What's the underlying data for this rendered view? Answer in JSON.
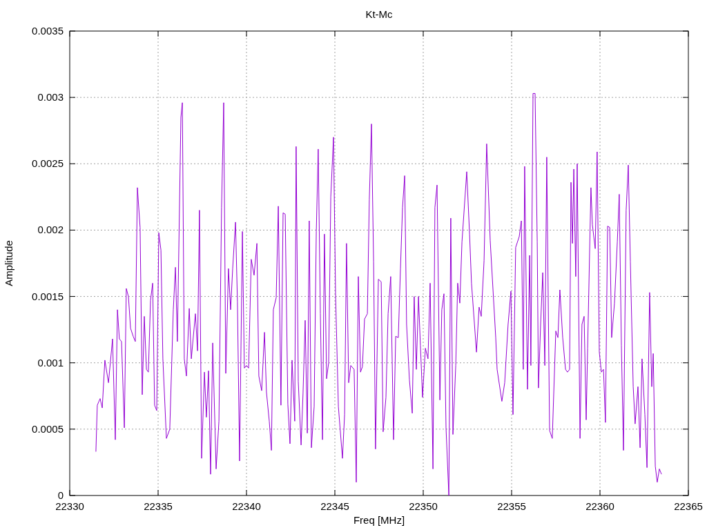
{
  "chart_data": {
    "type": "line",
    "grid": true,
    "title": "Kt-Mc",
    "xlabel": "Freq [MHz]",
    "ylabel": "Amplitude",
    "xlim": [
      22330,
      22365
    ],
    "ylim": [
      0,
      0.0035
    ],
    "xticks": [
      22330,
      22335,
      22340,
      22345,
      22350,
      22355,
      22360,
      22365
    ],
    "yticks": [
      0,
      0.0005,
      0.001,
      0.0015,
      0.002,
      0.0025,
      0.003,
      0.0035
    ],
    "x": [
      22331.48,
      22331.56,
      22331.72,
      22331.84,
      22331.99,
      22332.19,
      22332.42,
      22332.58,
      22332.7,
      22332.81,
      22332.93,
      22333.09,
      22333.2,
      22333.32,
      22333.44,
      22333.59,
      22333.71,
      22333.83,
      22333.98,
      22334.1,
      22334.22,
      22334.34,
      22334.45,
      22334.57,
      22334.69,
      22334.8,
      22334.92,
      22335.04,
      22335.16,
      22335.27,
      22335.47,
      22335.66,
      22335.86,
      22335.98,
      22336.09,
      22336.29,
      22336.37,
      22336.48,
      22336.6,
      22336.76,
      22336.88,
      22337.11,
      22337.23,
      22337.34,
      22337.46,
      22337.62,
      22337.73,
      22337.85,
      22337.97,
      22338.09,
      22338.28,
      22338.44,
      22338.59,
      22338.71,
      22338.83,
      22338.98,
      22339.1,
      22339.22,
      22339.38,
      22339.49,
      22339.61,
      22339.77,
      22339.88,
      22340.0,
      22340.12,
      22340.27,
      22340.43,
      22340.59,
      22340.7,
      22340.86,
      22341.02,
      22341.13,
      22341.29,
      22341.41,
      22341.52,
      22341.68,
      22341.8,
      22341.95,
      22342.07,
      22342.19,
      22342.34,
      22342.46,
      22342.58,
      22342.73,
      22342.81,
      22342.93,
      22343.09,
      22343.2,
      22343.32,
      22343.44,
      22343.55,
      22343.67,
      22343.83,
      22343.95,
      22344.06,
      22344.18,
      22344.3,
      22344.41,
      22344.53,
      22344.65,
      22344.77,
      22344.92,
      22345.04,
      22345.2,
      22345.43,
      22345.55,
      22345.66,
      22345.78,
      22345.9,
      22346.09,
      22346.21,
      22346.33,
      22346.45,
      22346.56,
      22346.68,
      22346.84,
      22346.95,
      22347.07,
      22347.19,
      22347.3,
      22347.46,
      22347.62,
      22347.73,
      22347.89,
      22348.01,
      22348.16,
      22348.32,
      22348.44,
      22348.59,
      22348.71,
      22348.83,
      22348.95,
      22349.06,
      22349.22,
      22349.38,
      22349.49,
      22349.61,
      22349.73,
      22349.84,
      22349.96,
      22350.12,
      22350.27,
      22350.39,
      22350.55,
      22350.66,
      22350.78,
      22350.94,
      22351.05,
      22351.17,
      22351.29,
      22351.45,
      22351.56,
      22351.68,
      22351.84,
      22351.95,
      22352.07,
      22352.19,
      22352.46,
      22352.62,
      22352.73,
      22353.01,
      22353.16,
      22353.28,
      22353.44,
      22353.59,
      22353.79,
      22354.1,
      22354.18,
      22354.45,
      22354.61,
      22354.8,
      22354.96,
      22355.08,
      22355.23,
      22355.43,
      22355.55,
      22355.66,
      22355.74,
      22355.9,
      22356.02,
      22356.09,
      22356.21,
      22356.33,
      22356.45,
      22356.52,
      22356.64,
      22356.76,
      22356.88,
      22356.99,
      22357.15,
      22357.3,
      22357.5,
      22357.62,
      22357.73,
      22357.89,
      22358.05,
      22358.16,
      22358.28,
      22358.36,
      22358.44,
      22358.52,
      22358.63,
      22358.71,
      22358.87,
      22358.98,
      22359.1,
      22359.22,
      22359.3,
      22359.49,
      22359.57,
      22359.73,
      22359.84,
      22359.96,
      22360.08,
      22360.2,
      22360.31,
      22360.43,
      22360.55,
      22360.66,
      22360.82,
      22360.98,
      22361.09,
      22361.21,
      22361.33,
      22361.48,
      22361.6,
      22361.72,
      22361.88,
      22361.99,
      22362.15,
      22362.27,
      22362.38,
      22362.54,
      22362.66,
      22362.81,
      22362.93,
      22363.01,
      22363.13,
      22363.24,
      22363.36,
      22363.48
    ],
    "series": [
      {
        "color": "#9400d3",
        "values": [
          0.00033,
          0.00068,
          0.00073,
          0.00066,
          0.00102,
          0.00085,
          0.00118,
          0.00042,
          0.0014,
          0.00118,
          0.00116,
          0.00051,
          0.00156,
          0.0015,
          0.00126,
          0.0012,
          0.00116,
          0.00232,
          0.00202,
          0.00076,
          0.00135,
          0.00095,
          0.00093,
          0.00147,
          0.0016,
          0.00068,
          0.00064,
          0.00198,
          0.00185,
          0.00103,
          0.00043,
          0.0005,
          0.0014,
          0.00172,
          0.00116,
          0.00285,
          0.00296,
          0.00103,
          0.0009,
          0.00141,
          0.00103,
          0.00137,
          0.00109,
          0.00215,
          0.00028,
          0.00093,
          0.00059,
          0.00094,
          0.00016,
          0.00115,
          0.0002,
          0.00056,
          0.00217,
          0.00296,
          0.00092,
          0.00171,
          0.0014,
          0.00171,
          0.00206,
          0.00146,
          0.00026,
          0.00199,
          0.00096,
          0.00098,
          0.00096,
          0.00178,
          0.00166,
          0.0019,
          0.0009,
          0.00079,
          0.00123,
          0.00078,
          0.00056,
          0.00034,
          0.0014,
          0.00149,
          0.00218,
          0.00068,
          0.00213,
          0.00212,
          0.00069,
          0.00039,
          0.00102,
          0.00056,
          0.00263,
          0.00086,
          0.00038,
          0.00077,
          0.00132,
          0.00047,
          0.00207,
          0.00036,
          0.00067,
          0.00199,
          0.00261,
          0.00137,
          0.00042,
          0.00197,
          0.00088,
          0.001,
          0.00225,
          0.0027,
          0.00152,
          0.00067,
          0.00028,
          0.00061,
          0.0019,
          0.00085,
          0.00098,
          0.00095,
          0.0001,
          0.00165,
          0.00093,
          0.00097,
          0.00133,
          0.00137,
          0.00223,
          0.0028,
          0.00176,
          0.00035,
          0.00163,
          0.00161,
          0.00048,
          0.00074,
          0.00137,
          0.00165,
          0.00042,
          0.0012,
          0.00119,
          0.00171,
          0.00217,
          0.00241,
          0.00129,
          0.00087,
          0.00062,
          0.0015,
          0.00095,
          0.0015,
          0.00113,
          0.00074,
          0.00111,
          0.00103,
          0.0016,
          0.0002,
          0.00217,
          0.00234,
          0.00072,
          0.0014,
          0.00152,
          0.00051,
          0,
          0.00209,
          0.00046,
          0.00098,
          0.0016,
          0.00145,
          0.00191,
          0.00244,
          0.00197,
          0.0016,
          0.00108,
          0.00142,
          0.00135,
          0.00177,
          0.00265,
          0.00192,
          0.00119,
          0.00095,
          0.00071,
          0.00085,
          0.00129,
          0.00154,
          0.00061,
          0.00187,
          0.00195,
          0.00207,
          0.00095,
          0.00248,
          0.0008,
          0.00181,
          0.00098,
          0.00303,
          0.00303,
          0.00191,
          0.00081,
          0.00129,
          0.00168,
          0.00098,
          0.00255,
          0.00049,
          0.00043,
          0.00124,
          0.00119,
          0.00155,
          0.00119,
          0.00095,
          0.00093,
          0.00095,
          0.00236,
          0.0019,
          0.00246,
          0.00165,
          0.0025,
          0.00043,
          0.00129,
          0.00135,
          0.00057,
          0.00111,
          0.00232,
          0.00204,
          0.00186,
          0.00259,
          0.00108,
          0.00093,
          0.00095,
          0.00055,
          0.00203,
          0.00202,
          0.00119,
          0.00145,
          0.00191,
          0.00227,
          0.00113,
          0.00034,
          0.00215,
          0.00249,
          0.00176,
          0.00082,
          0.00054,
          0.00082,
          0.00036,
          0.00103,
          0.00061,
          0.00021,
          0.00153,
          0.00082,
          0.00107,
          0.00022,
          0.0001,
          0.0002,
          0.00016
        ]
      }
    ]
  }
}
